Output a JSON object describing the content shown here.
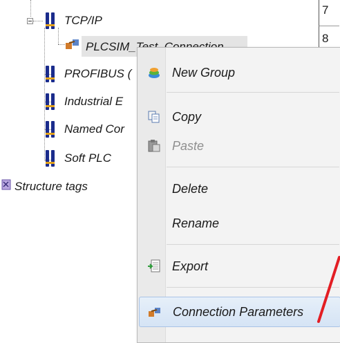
{
  "tree": {
    "items": [
      {
        "label": "TCP/IP"
      },
      {
        "label": "PLCSIM_Test_Connection"
      },
      {
        "label": "PROFIBUS ("
      },
      {
        "label": "Industrial E"
      },
      {
        "label": "Named Cor"
      },
      {
        "label": "Soft PLC"
      },
      {
        "label": "Structure tags"
      }
    ]
  },
  "grid": {
    "rows": [
      "7",
      "8"
    ]
  },
  "context_menu": {
    "items": [
      {
        "label": "New Group",
        "icon": "new-group-icon",
        "enabled": true
      },
      {
        "label": "Copy",
        "icon": "copy-icon",
        "enabled": true
      },
      {
        "label": "Paste",
        "icon": "paste-icon",
        "enabled": false
      },
      {
        "label": "Delete",
        "icon": "",
        "enabled": true
      },
      {
        "label": "Rename",
        "icon": "",
        "enabled": true
      },
      {
        "label": "Export",
        "icon": "export-icon",
        "enabled": true
      },
      {
        "label": "Connection Parameters",
        "icon": "connection-parameters-icon",
        "enabled": true,
        "highlighted": true
      }
    ]
  },
  "colors": {
    "annotation": "#e31e24",
    "menu_highlight": "#d5e4f5",
    "network_icon": "#1b2c8c"
  }
}
